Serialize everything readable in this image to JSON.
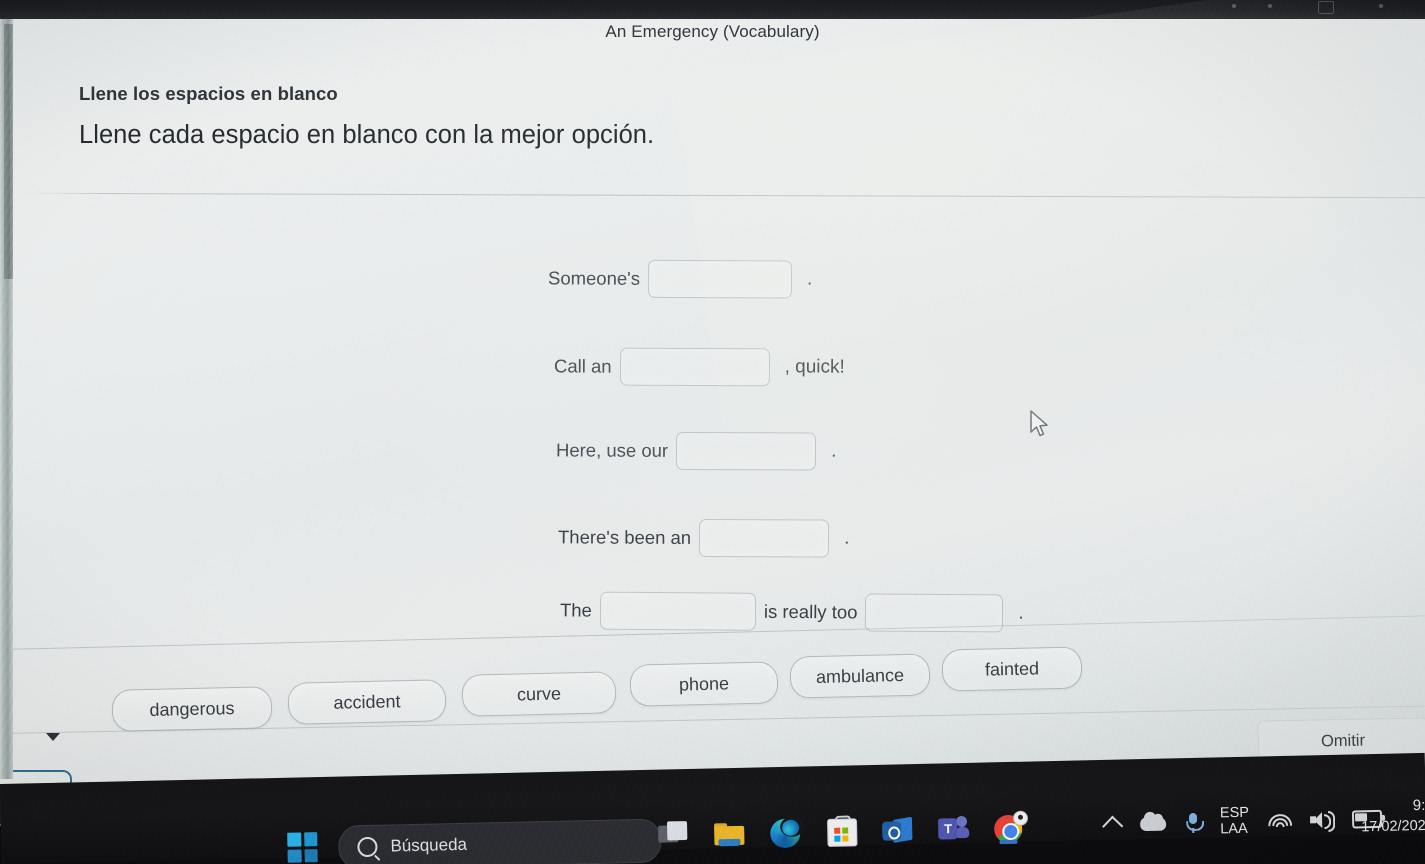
{
  "window": {
    "site_title": "An Emergency (Vocabulary)"
  },
  "exercise": {
    "instruction_small": "Llene los espacios en blanco",
    "instruction_large": "Llene cada espacio en blanco con la mejor opción.",
    "questions": [
      {
        "id": "q1",
        "before": "Someone's",
        "after": "",
        "tail": "."
      },
      {
        "id": "q2",
        "before": "Call an",
        "after": "",
        "tail": ", quick!"
      },
      {
        "id": "q3",
        "before": "Here, use our",
        "after": "",
        "tail": "."
      },
      {
        "id": "q4",
        "before": "There's been an",
        "after": "",
        "tail": "."
      },
      {
        "id": "q5",
        "before": "The",
        "middle": "is really too",
        "after": "",
        "tail": "."
      }
    ],
    "word_bank": [
      {
        "id": "dangerous",
        "label": "dangerous"
      },
      {
        "id": "accident",
        "label": "accident"
      },
      {
        "id": "curve",
        "label": "curve"
      },
      {
        "id": "phone",
        "label": "phone"
      },
      {
        "id": "ambulance",
        "label": "ambulance"
      },
      {
        "id": "fainted",
        "label": "fainted"
      }
    ],
    "skip_button": "Omitir"
  },
  "taskbar": {
    "search_placeholder": "Búsqueda",
    "apps": [
      {
        "id": "task-view",
        "name": "task-view-icon"
      },
      {
        "id": "explorer",
        "name": "file-explorer-icon"
      },
      {
        "id": "edge",
        "name": "edge-icon"
      },
      {
        "id": "store",
        "name": "microsoft-store-icon"
      },
      {
        "id": "outlook",
        "name": "outlook-icon"
      },
      {
        "id": "teams",
        "name": "teams-icon"
      },
      {
        "id": "chrome",
        "name": "chrome-icon"
      }
    ],
    "tray": {
      "language_line1": "ESP",
      "language_line2": "LAA",
      "time": "9:",
      "date": "17/02/202"
    }
  },
  "colors": {
    "page_bg": "#e7eaea",
    "taskbar_bg": "#121215",
    "text": "#343b41",
    "focus_outline": "#2d6f91"
  }
}
